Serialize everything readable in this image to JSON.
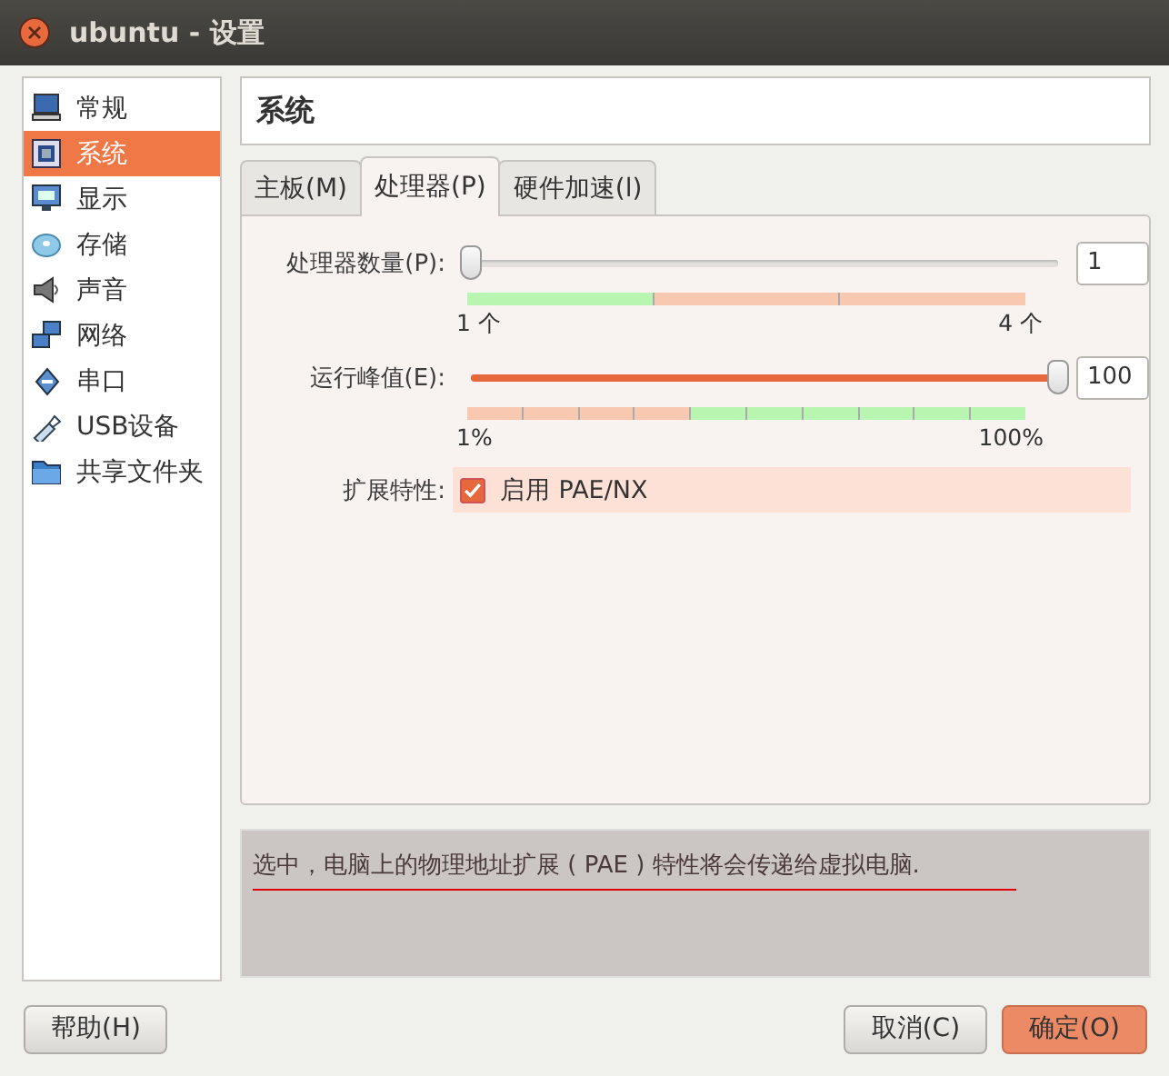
{
  "window": {
    "title": "ubuntu - 设置"
  },
  "sidebar": {
    "items": [
      {
        "label": "常规",
        "selected": false
      },
      {
        "label": "系统",
        "selected": true
      },
      {
        "label": "显示",
        "selected": false
      },
      {
        "label": "存储",
        "selected": false
      },
      {
        "label": "声音",
        "selected": false
      },
      {
        "label": "网络",
        "selected": false
      },
      {
        "label": "串口",
        "selected": false
      },
      {
        "label": "USB设备",
        "selected": false
      },
      {
        "label": "共享文件夹",
        "selected": false
      }
    ]
  },
  "page_title": "系统",
  "tabs": [
    {
      "label": "主板(M)",
      "selected": false
    },
    {
      "label": "处理器(P)",
      "selected": true
    },
    {
      "label": "硬件加速(l)",
      "selected": false
    }
  ],
  "sliders": [
    {
      "label": "处理器数量(P):",
      "level": 0,
      "value": "1",
      "min_label": "1 个",
      "max_label": "4 个",
      "segments": [
        {
          "color": "#b8f5b0"
        },
        {
          "color": "#f8c8b0"
        },
        {
          "color": "#f8c8b0"
        }
      ]
    },
    {
      "label": "运行峰值(E):",
      "level": 1,
      "value": "100",
      "min_label": "1%",
      "max_label": "100%",
      "segments": [
        {
          "color": "#f8c8b0"
        },
        {
          "color": "#f8c8b0"
        },
        {
          "color": "#f8c8b0"
        },
        {
          "color": "#f8c8b0"
        },
        {
          "color": "#b8f5b0"
        },
        {
          "color": "#b8f5b0"
        },
        {
          "color": "#b8f5b0"
        },
        {
          "color": "#b8f5b0"
        },
        {
          "color": "#b8f5b0"
        },
        {
          "color": "#b8f5b0"
        }
      ]
    }
  ],
  "extended": {
    "label": "扩展特性:",
    "option": "启用 PAE/NX",
    "checked": true
  },
  "description": "选中，电脑上的物理地址扩展 ( PAE ) 特性将会传递给虚拟电脑.",
  "buttons": {
    "help": "帮助(H)",
    "cancel": "取消(C)",
    "ok": "确定(O)"
  }
}
